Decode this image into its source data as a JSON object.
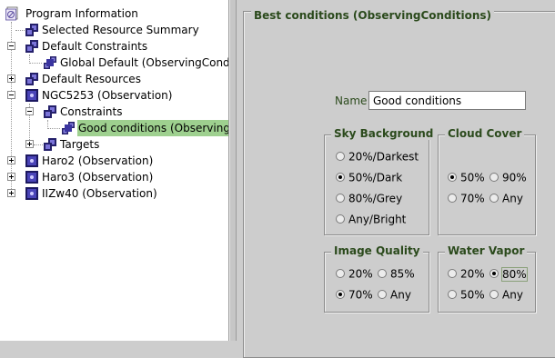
{
  "tree": {
    "items": [
      {
        "label": "Program Information"
      },
      {
        "label": "Selected Resource Summary"
      },
      {
        "label": "Default Constraints"
      },
      {
        "label": "Global Default (ObservingCondit"
      },
      {
        "label": "Default Resources"
      },
      {
        "label": "NGC5253 (Observation)"
      },
      {
        "label": "Constraints"
      },
      {
        "label": "Good conditions (ObservingC"
      },
      {
        "label": "Targets"
      },
      {
        "label": "Haro2 (Observation)"
      },
      {
        "label": "Haro3 (Observation)"
      },
      {
        "label": "IIZw40 (Observation)"
      }
    ],
    "selected_index": 7
  },
  "editor": {
    "title": "Best conditions (ObservingConditions)",
    "name_label": "Name",
    "name_value": "Good conditions"
  },
  "groups": {
    "sky_background": {
      "title": "Sky Background",
      "options": [
        "20%/Darkest",
        "50%/Dark",
        "80%/Grey",
        "Any/Bright"
      ],
      "selected": "50%/Dark"
    },
    "cloud_cover": {
      "title": "Cloud Cover",
      "options": [
        "50%",
        "90%",
        "70%",
        "Any"
      ],
      "selected": "50%"
    },
    "image_quality": {
      "title": "Image Quality",
      "options": [
        "20%",
        "85%",
        "70%",
        "Any"
      ],
      "selected": "70%"
    },
    "water_vapor": {
      "title": "Water Vapor",
      "options": [
        "20%",
        "80%",
        "50%",
        "Any"
      ],
      "selected": "80%"
    }
  },
  "colors": {
    "selection": "#9ed08f",
    "group_title": "#2b4a1c",
    "panel_bg": "#cdcdcd"
  }
}
